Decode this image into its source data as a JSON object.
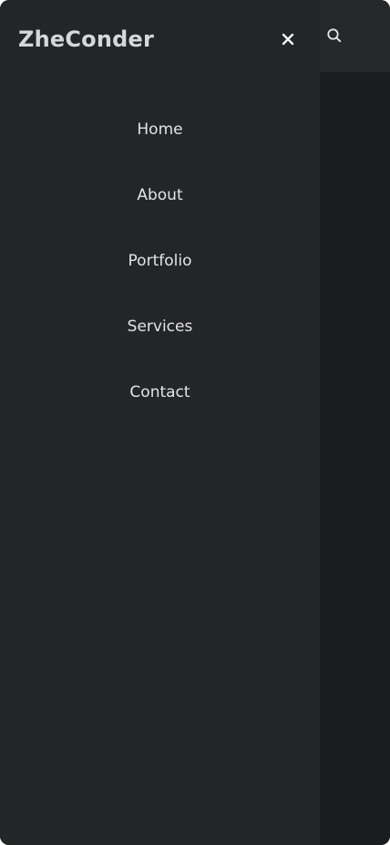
{
  "brand": {
    "name": "ZheConder"
  },
  "header": {
    "search_icon": "search-icon",
    "close_icon": "close-icon"
  },
  "nav": {
    "items": [
      {
        "label": "Home"
      },
      {
        "label": "About"
      },
      {
        "label": "Portfolio"
      },
      {
        "label": "Services"
      },
      {
        "label": "Contact"
      }
    ]
  },
  "colors": {
    "drawer_bg": "#242527",
    "page_bg": "#1b1c1e",
    "header_bg": "#262729",
    "text": "#e3e4e6"
  }
}
